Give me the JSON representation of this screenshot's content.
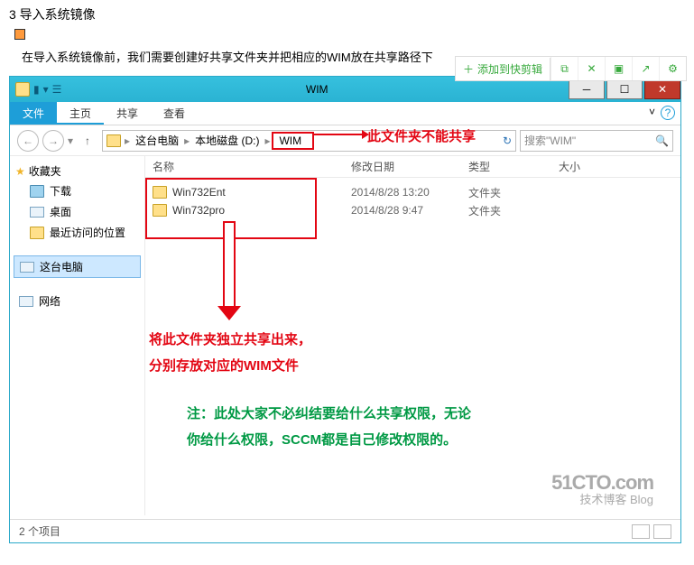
{
  "doc": {
    "section_title": "3 导入系统镜像",
    "intro": "在导入系统镜像前，我们需要创建好共享文件夹并把相应的WIM放在共享路径下"
  },
  "toolbar": {
    "add_label": "添加到快剪辑"
  },
  "window": {
    "title": "WIM",
    "ribbon": {
      "file": "文件",
      "home": "主页",
      "share": "共享",
      "view": "查看"
    },
    "breadcrumb": {
      "pc": "这台电脑",
      "disk": "本地磁盘 (D:)",
      "folder": "WIM"
    },
    "search_placeholder": "搜索\"WIM\"",
    "sidebar": {
      "favorites": "收藏夹",
      "downloads": "下载",
      "desktop": "桌面",
      "recent": "最近访问的位置",
      "pc": "这台电脑",
      "network": "网络"
    },
    "columns": {
      "name": "名称",
      "date": "修改日期",
      "type": "类型",
      "size": "大小"
    },
    "rows": [
      {
        "name": "Win732Ent",
        "date": "2014/8/28 13:20",
        "type": "文件夹"
      },
      {
        "name": "Win732pro",
        "date": "2014/8/28 9:47",
        "type": "文件夹"
      }
    ],
    "status": "2 个项目"
  },
  "annotations": {
    "cant_share": "此文件夹不能共享",
    "share_out_l1": "将此文件夹独立共享出来，",
    "share_out_l2": "分别存放对应的WIM文件",
    "note_l1": "注：此处大家不必纠结要给什么共享权限，无论",
    "note_l2": "你给什么权限，SCCM都是自己修改权限的。"
  },
  "watermark": {
    "line1": "51CTO.com",
    "line2": "技术博客  Blog"
  }
}
